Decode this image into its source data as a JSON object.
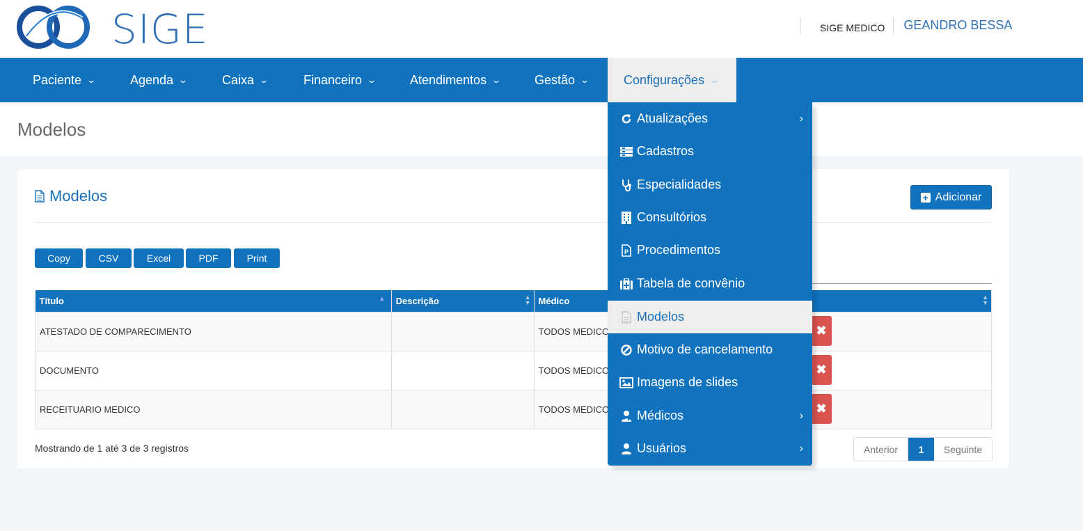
{
  "header": {
    "logo_text": "SIGE",
    "company": "SIGE MEDICO",
    "username": "GEANDRO BESSA"
  },
  "nav": {
    "items": [
      {
        "label": "Paciente"
      },
      {
        "label": "Agenda"
      },
      {
        "label": "Caixa"
      },
      {
        "label": "Financeiro"
      },
      {
        "label": "Atendimentos"
      },
      {
        "label": "Gestão"
      },
      {
        "label": "Configurações",
        "active": true
      }
    ]
  },
  "page": {
    "title": "Modelos"
  },
  "card": {
    "title": "Modelos",
    "add_label": "Adicionar",
    "export_buttons": [
      "Copy",
      "CSV",
      "Excel",
      "PDF",
      "Print"
    ]
  },
  "table": {
    "columns": [
      "Título",
      "Descrição",
      "Médico",
      ""
    ],
    "rows": [
      {
        "titulo": "ATESTADO DE COMPARECIMENTO",
        "descricao": "",
        "medico": "TODOS MEDICOS"
      },
      {
        "titulo": "DOCUMENTO",
        "descricao": "",
        "medico": "TODOS MEDICOS"
      },
      {
        "titulo": "RECEITUARIO MEDICO",
        "descricao": "",
        "medico": "TODOS MEDICOS"
      }
    ],
    "delete_icon": "times-icon"
  },
  "footer": {
    "info": "Mostrando de 1 até 3 de 3 registros",
    "prev": "Anterior",
    "page": "1",
    "next": "Seguinte"
  },
  "menu": {
    "items": [
      {
        "label": "Atualizações",
        "icon": "refresh-icon",
        "submenu": true
      },
      {
        "label": "Cadastros",
        "icon": "list-icon"
      },
      {
        "label": "Especialidades",
        "icon": "stethoscope-icon"
      },
      {
        "label": "Consultórios",
        "icon": "building-icon"
      },
      {
        "label": "Procedimentos",
        "icon": "file-p-icon"
      },
      {
        "label": "Tabela de convênio",
        "icon": "medkit-icon"
      },
      {
        "label": "Modelos",
        "icon": "document-icon",
        "active": true
      },
      {
        "label": "Motivo de cancelamento",
        "icon": "ban-icon"
      },
      {
        "label": "Imagens de slides",
        "icon": "image-icon"
      },
      {
        "label": "Médicos",
        "icon": "user-md-icon",
        "submenu": true
      },
      {
        "label": "Usuários",
        "icon": "user-icon",
        "submenu": true
      }
    ]
  },
  "colors": {
    "primary": "#1172be",
    "danger": "#d9534f",
    "background": "#f2f5f9"
  }
}
